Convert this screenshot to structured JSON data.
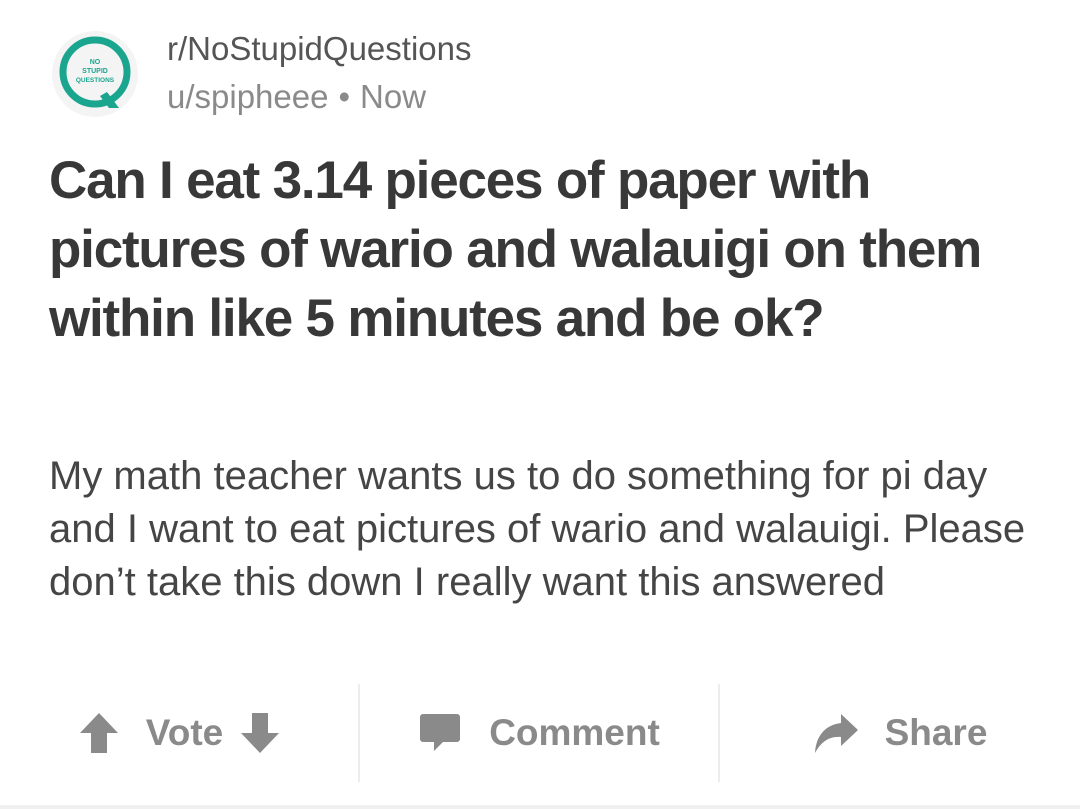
{
  "post": {
    "subreddit": "r/NoStupidQuestions",
    "user": "u/spipheee",
    "separator": "•",
    "time": "Now",
    "title": "Can I eat 3.14 pieces of paper with pictures of wario and walauigi on them within like 5 minutes and be ok?",
    "body": "My math teacher wants us to do something for pi day and I want to eat pictures of wario and walauigi. Please don’t take this down I really want this answered"
  },
  "logo": {
    "line1": "NO",
    "line2": "STUPID",
    "line3": "QUESTIONS",
    "color": "#1aa58f"
  },
  "actions": {
    "vote_label": "Vote",
    "comment_label": "Comment",
    "share_label": "Share",
    "icons": [
      "upvote-arrow-icon",
      "downvote-arrow-icon",
      "comment-bubble-icon",
      "share-arrow-icon"
    ],
    "icon_color": "#8a8a8a"
  }
}
